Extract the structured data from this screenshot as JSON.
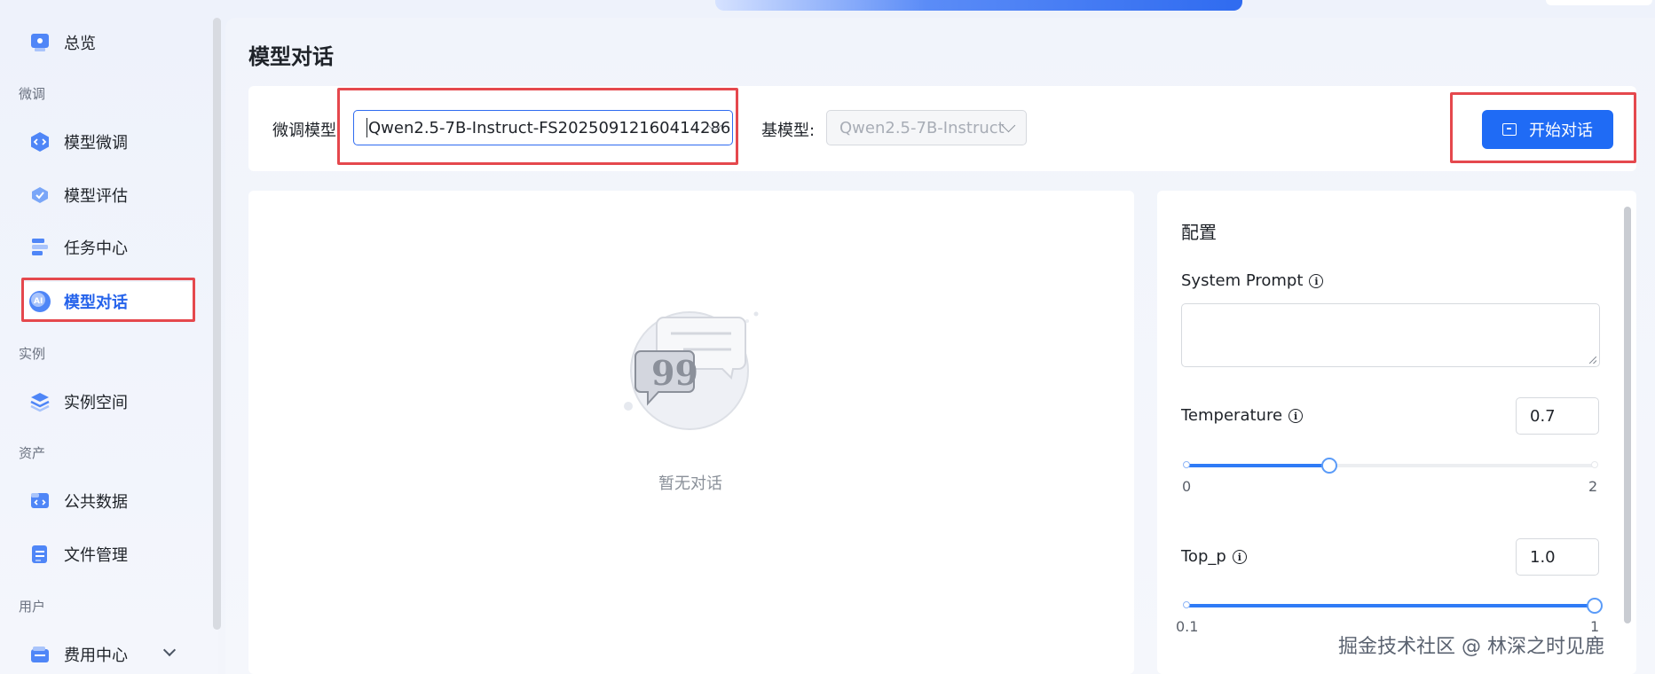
{
  "sidebar": {
    "overview": {
      "label": "总览",
      "icon": "overview-icon"
    },
    "sections": {
      "finetune": "微调",
      "instance": "实例",
      "assets": "资产",
      "user": "用户"
    },
    "items": [
      {
        "label": "模型微调",
        "icon": "model-finetune-icon"
      },
      {
        "label": "模型评估",
        "icon": "model-evaluation-icon"
      },
      {
        "label": "任务中心",
        "icon": "task-center-icon"
      },
      {
        "label": "模型对话",
        "icon": "ai-chat-icon",
        "active": true
      },
      {
        "label": "实例空间",
        "icon": "layers-icon"
      },
      {
        "label": "公共数据",
        "icon": "public-data-icon"
      },
      {
        "label": "文件管理",
        "icon": "file-icon"
      },
      {
        "label": "费用中心",
        "icon": "billing-icon"
      }
    ]
  },
  "main": {
    "title": "模型对话",
    "finetuned_model": {
      "label": "微调模型:",
      "value": "Qwen2.5-7B-Instruct-FS20250912160414286"
    },
    "base_model": {
      "label": "基模型:",
      "value": "Qwen2.5-7B-Instruct"
    },
    "start_button": "开始对话",
    "empty_state": "暂无对话"
  },
  "config": {
    "title": "配置",
    "system_prompt": {
      "label": "System Prompt",
      "value": ""
    },
    "temperature": {
      "label": "Temperature",
      "value": "0.7",
      "min": "0",
      "max": "2",
      "level": 0.35
    },
    "top_p": {
      "label": "Top_p",
      "value": "1.0",
      "min": "0.1",
      "max": "1",
      "level": 1.0
    }
  },
  "watermark": "掘金技术社区 @ 林深之时见鹿",
  "colors": {
    "accent": "#1f6bf5",
    "highlight_box": "#e5484d",
    "active_text": "#2563eb"
  }
}
